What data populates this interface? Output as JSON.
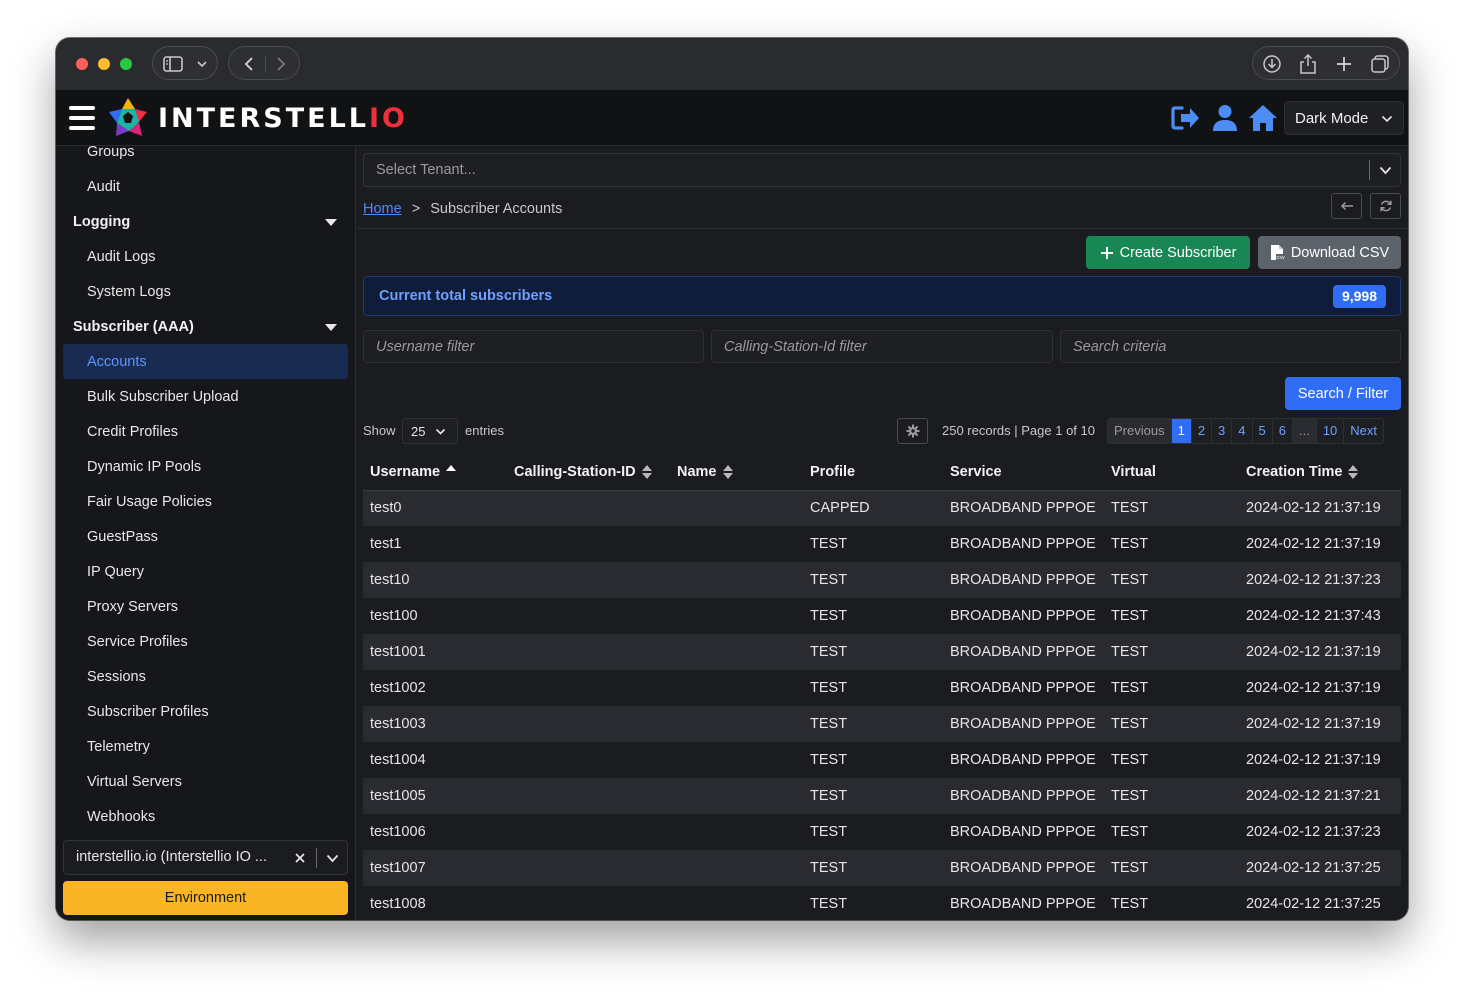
{
  "app": {
    "brand_main": "INTERSTELL",
    "brand_io": "IO",
    "dark_mode_label": "Dark Mode"
  },
  "sidebar": {
    "items": {
      "groups": "Groups",
      "audit": "Audit",
      "logging": "Logging",
      "audit_logs": "Audit Logs",
      "system_logs": "System Logs",
      "subscriber_aaa": "Subscriber (AAA)",
      "accounts": "Accounts",
      "bulk_upload": "Bulk Subscriber Upload",
      "credit_profiles": "Credit Profiles",
      "dynamic_ip_pools": "Dynamic IP Pools",
      "fair_usage": "Fair Usage Policies",
      "guestpass": "GuestPass",
      "ip_query": "IP Query",
      "proxy_servers": "Proxy Servers",
      "service_profiles": "Service Profiles",
      "sessions": "Sessions",
      "subscriber_profiles": "Subscriber Profiles",
      "telemetry": "Telemetry",
      "virtual_servers": "Virtual Servers",
      "webhooks": "Webhooks"
    },
    "tenant_value": "interstellio.io (Interstellio IO ...",
    "environment_label": "Environment"
  },
  "main": {
    "tenant_placeholder": "Select Tenant...",
    "breadcrumb": {
      "home": "Home",
      "sep": ">",
      "current": "Subscriber Accounts"
    },
    "create_label": "Create Subscriber",
    "download_label": "Download CSV",
    "total_label": "Current total subscribers",
    "total_value": "9,998",
    "filters": {
      "username": "Username filter",
      "calling": "Calling-Station-Id filter",
      "criteria": "Search criteria"
    },
    "search_label": "Search / Filter",
    "show_label": "Show",
    "entries_value": "25",
    "entries_label": "entries",
    "records_text": "250 records | Page 1 of 10",
    "pager": [
      "Previous",
      "1",
      "2",
      "3",
      "4",
      "5",
      "6",
      "...",
      "10",
      "Next"
    ],
    "columns": [
      "Username",
      "Calling-Station-ID",
      "Name",
      "Profile",
      "Service",
      "Virtual",
      "Creation Time"
    ],
    "rows": [
      [
        "test0",
        "",
        "",
        "CAPPED",
        "BROADBAND PPPOE",
        "TEST",
        "2024-02-12 21:37:19"
      ],
      [
        "test1",
        "",
        "",
        "TEST",
        "BROADBAND PPPOE",
        "TEST",
        "2024-02-12 21:37:19"
      ],
      [
        "test10",
        "",
        "",
        "TEST",
        "BROADBAND PPPOE",
        "TEST",
        "2024-02-12 21:37:23"
      ],
      [
        "test100",
        "",
        "",
        "TEST",
        "BROADBAND PPPOE",
        "TEST",
        "2024-02-12 21:37:43"
      ],
      [
        "test1001",
        "",
        "",
        "TEST",
        "BROADBAND PPPOE",
        "TEST",
        "2024-02-12 21:37:19"
      ],
      [
        "test1002",
        "",
        "",
        "TEST",
        "BROADBAND PPPOE",
        "TEST",
        "2024-02-12 21:37:19"
      ],
      [
        "test1003",
        "",
        "",
        "TEST",
        "BROADBAND PPPOE",
        "TEST",
        "2024-02-12 21:37:19"
      ],
      [
        "test1004",
        "",
        "",
        "TEST",
        "BROADBAND PPPOE",
        "TEST",
        "2024-02-12 21:37:19"
      ],
      [
        "test1005",
        "",
        "",
        "TEST",
        "BROADBAND PPPOE",
        "TEST",
        "2024-02-12 21:37:21"
      ],
      [
        "test1006",
        "",
        "",
        "TEST",
        "BROADBAND PPPOE",
        "TEST",
        "2024-02-12 21:37:23"
      ],
      [
        "test1007",
        "",
        "",
        "TEST",
        "BROADBAND PPPOE",
        "TEST",
        "2024-02-12 21:37:25"
      ],
      [
        "test1008",
        "",
        "",
        "TEST",
        "BROADBAND PPPOE",
        "TEST",
        "2024-02-12 21:37:25"
      ]
    ]
  },
  "icons": {
    "logout": "logout-icon",
    "user": "user-icon",
    "home": "home-icon",
    "gear": "gear-icon",
    "csv": "csv-file-icon"
  },
  "colors": {
    "accent": "#2f6df6",
    "success": "#198754",
    "environment": "#f9b524",
    "header_icons": "#4e8cf5"
  }
}
